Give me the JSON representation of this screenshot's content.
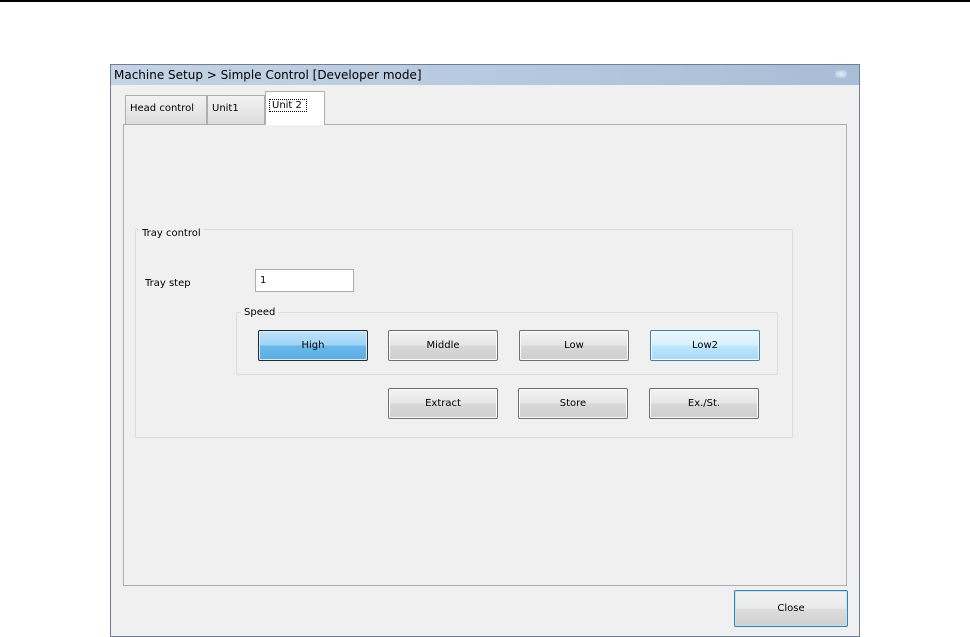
{
  "window": {
    "title": "Machine Setup > Simple Control [Developer mode]"
  },
  "tabs": [
    {
      "label": "Head control",
      "active": false
    },
    {
      "label": "Unit1",
      "active": false
    },
    {
      "label": "Unit 2",
      "active": true
    }
  ],
  "tray_control": {
    "group_title": "Tray control",
    "tray_step_label": "Tray step",
    "tray_step_value": "1",
    "speed": {
      "group_title": "Speed",
      "buttons": [
        {
          "label": "High",
          "state": "selected"
        },
        {
          "label": "Middle",
          "state": "normal"
        },
        {
          "label": "Low",
          "state": "normal"
        },
        {
          "label": "Low2",
          "state": "highlighted"
        }
      ]
    },
    "actions": [
      {
        "label": "Extract"
      },
      {
        "label": "Store"
      },
      {
        "label": "Ex./St."
      }
    ]
  },
  "footer": {
    "close_label": "Close"
  },
  "colors": {
    "titlebar": "#b7c9de",
    "selected_button": "#6ab8ea",
    "highlight_button": "#bee6fd",
    "dialog_background": "#f0f0f0"
  }
}
